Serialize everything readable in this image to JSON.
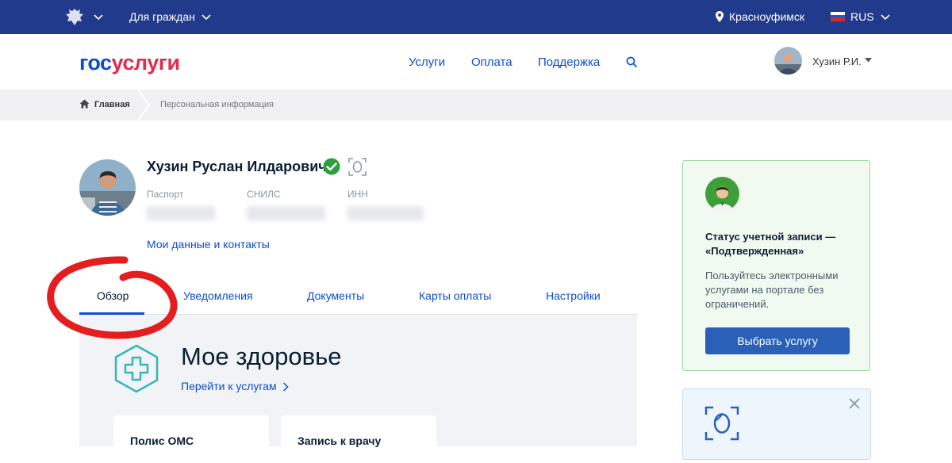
{
  "topbar": {
    "citizens_label": "Для граждан",
    "city": "Красноуфимск",
    "language": "RUS"
  },
  "header": {
    "logo_part1": "гос",
    "logo_part2": "услуги",
    "nav": [
      "Услуги",
      "Оплата",
      "Поддержка"
    ],
    "user_short": "Хузин Р.И."
  },
  "breadcrumb": {
    "home": "Главная",
    "current": "Персональная информация"
  },
  "profile": {
    "full_name": "Хузин Руслан Илдарович",
    "passport_label": "Паспорт",
    "snils_label": "СНИЛС",
    "inn_label": "ИНН",
    "my_data_link": "Мои данные и контакты"
  },
  "tabs": [
    "Обзор",
    "Уведомления",
    "Документы",
    "Карты оплаты",
    "Настройки"
  ],
  "health": {
    "title": "Мое здоровье",
    "link": "Перейти к услугам",
    "cards": [
      "Полис ОМС",
      "Запись к врачу"
    ]
  },
  "status_panel": {
    "title": "Статус учетной записи — «Подтвержденная»",
    "description": "Пользуйтесь электронными услугами на портале без ограничений.",
    "button": "Выбрать услугу"
  },
  "colors": {
    "topbar": "#223a8c",
    "link": "#0d4cd3",
    "logo_red": "#e12c4b",
    "button": "#2a60b7",
    "verified": "#2e9e3e",
    "annotation": "#e41e1e"
  }
}
